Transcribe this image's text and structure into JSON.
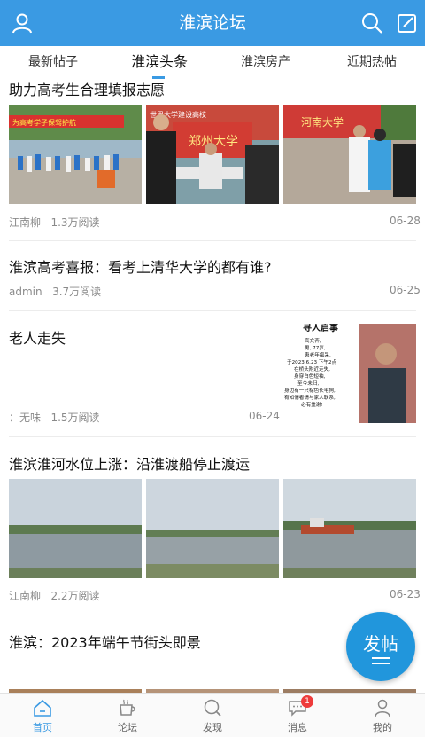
{
  "header": {
    "title": "淮滨论坛",
    "left_icon": "user-icon",
    "right_icons": [
      "search-icon",
      "edit-icon"
    ],
    "color": "#3a9ae3"
  },
  "tabs": [
    {
      "label": "最新帖子",
      "active": false
    },
    {
      "label": "淮滨头条",
      "active": true
    },
    {
      "label": "淮滨房产",
      "active": false
    },
    {
      "label": "近期热帖",
      "active": false
    }
  ],
  "posts": [
    {
      "title": "助力高考生合理填报志愿",
      "author": "江南柳",
      "views": "1.3万阅读",
      "date": "06-28",
      "image_text": [
        "为高考学子保驾护航",
        "世界大学建设高校",
        "郑州大学",
        "河南大学"
      ]
    },
    {
      "title": "淮滨高考喜报：看考上清华大学的都有谁?",
      "author": "admin",
      "views": "3.7万阅读",
      "date": "06-25"
    },
    {
      "title": "老人走失",
      "author": "：无味",
      "views": "1.5万阅读",
      "date": "06-24",
      "notice": [
        "寻人启事",
        "高文齐,",
        "男, 77岁,",
        "患老年痴呆,",
        "于2023.6.23 下午2点",
        "在桥头附近走失,",
        "身穿白色短袖,",
        "至今未归,",
        "身边有一只棕色长毛狗,",
        "有知情者请与家人联系,",
        "必有重谢!"
      ]
    },
    {
      "title": "淮滨淮河水位上涨：沿淮渡船停止渡运",
      "author": "江南柳",
      "views": "2.2万阅读",
      "date": "06-23"
    },
    {
      "title": "淮滨：2023年端午节街头即景"
    }
  ],
  "fab": {
    "label": "发帖",
    "color": "#2196dc"
  },
  "tabbar": [
    {
      "label": "首页",
      "icon": "home-icon",
      "active": true
    },
    {
      "label": "论坛",
      "icon": "coffee-cup-icon",
      "active": false
    },
    {
      "label": "发现",
      "icon": "compass-icon",
      "active": false
    },
    {
      "label": "消息",
      "icon": "chat-icon",
      "active": false,
      "badge": "1"
    },
    {
      "label": "我的",
      "icon": "profile-icon",
      "active": false
    }
  ]
}
